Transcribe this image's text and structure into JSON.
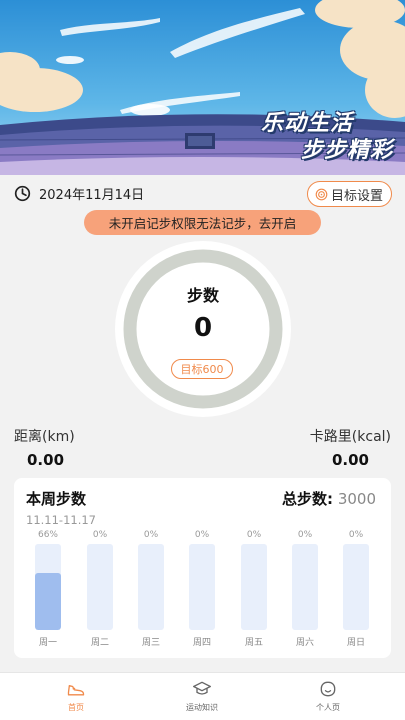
{
  "hero": {
    "slogan_line1": "乐动生活",
    "slogan_line2": "步步精彩"
  },
  "header": {
    "date": "2024年11月14日",
    "goal_button_label": "目标设置"
  },
  "permission_banner": "未开启记步权限无法记步，去开启",
  "steps_ring": {
    "title": "步数",
    "value": "0",
    "goal_label": "目标600"
  },
  "metrics": {
    "distance_label": "距离(km)",
    "distance_value": "0.00",
    "calories_label": "卡路里(kcal)",
    "calories_value": "0.00"
  },
  "weekly": {
    "title": "本周步数",
    "total_label": "总步数:",
    "total_value": "3000",
    "range": "11.11-11.17",
    "days": [
      {
        "day": "周一",
        "pct": "66%",
        "fill": 0.66
      },
      {
        "day": "周二",
        "pct": "0%",
        "fill": 0
      },
      {
        "day": "周三",
        "pct": "0%",
        "fill": 0
      },
      {
        "day": "周四",
        "pct": "0%",
        "fill": 0
      },
      {
        "day": "周五",
        "pct": "0%",
        "fill": 0
      },
      {
        "day": "周六",
        "pct": "0%",
        "fill": 0
      },
      {
        "day": "周日",
        "pct": "0%",
        "fill": 0
      }
    ]
  },
  "tabbar": {
    "tabs": [
      {
        "label": "首页",
        "icon": "shoe-icon",
        "active": true
      },
      {
        "label": "运动知识",
        "icon": "graduation-cap-icon",
        "active": false
      },
      {
        "label": "个人页",
        "icon": "face-icon",
        "active": false
      }
    ]
  },
  "colors": {
    "accent": "#f08a4b",
    "banner": "#f7a27a",
    "bar_fill": "#9fbdee",
    "bar_track": "#e8effb",
    "ring": "#cfd3cc"
  }
}
